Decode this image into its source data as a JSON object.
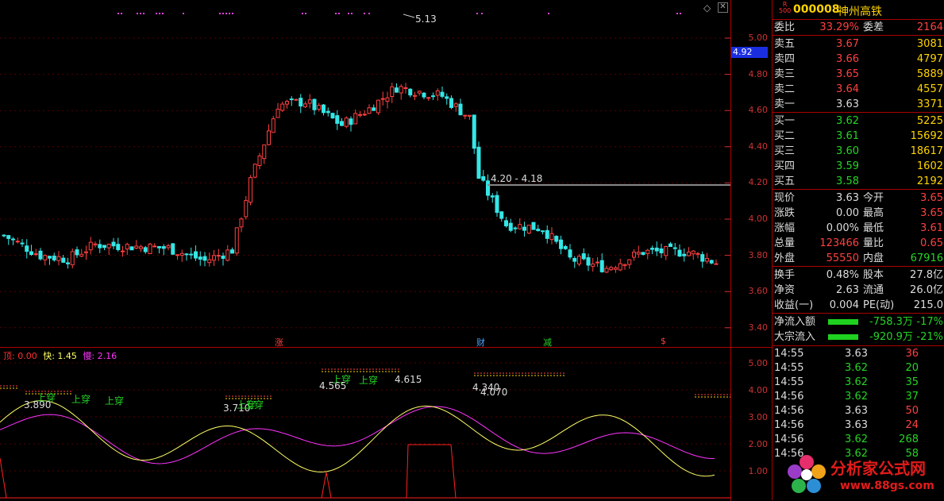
{
  "stock": {
    "board_tag": "R\n500",
    "code": "000008",
    "name": "神州高铁"
  },
  "chart": {
    "price_ticks": [
      "5.00",
      "4.80",
      "4.60",
      "4.40",
      "4.20",
      "4.00",
      "3.80",
      "3.60",
      "3.40"
    ],
    "current_price_tag": "4.92",
    "high_label": "5.13",
    "range_label": "4.20 - 4.18",
    "event_flags": [
      {
        "label": "涨",
        "color": "#ff4040"
      },
      {
        "label": "财",
        "color": "#4aa3ff"
      },
      {
        "label": "减",
        "color": "#25d425"
      },
      {
        "label": "$",
        "color": "#ff4040"
      }
    ],
    "indicator_ticks": [
      "5.00",
      "4.00",
      "3.00",
      "2.00",
      "1.00"
    ],
    "legend": {
      "top_label": "顶: 0.00",
      "fast_label": "快: 1.45",
      "slow_label": "慢: 2.16"
    },
    "annotations": [
      {
        "text": "上穿",
        "color": "#25d425"
      },
      {
        "text": "上穿",
        "color": "#25d425"
      },
      {
        "text": "上穿",
        "color": "#25d425"
      },
      {
        "text": "3.890",
        "color": "#ddd"
      },
      {
        "text": "3.710",
        "color": "#ddd"
      },
      {
        "text": "上穿",
        "color": "#25d425"
      },
      {
        "text": "上穿",
        "color": "#25d425"
      },
      {
        "text": "上穿",
        "color": "#25d425"
      },
      {
        "text": "上穿",
        "color": "#25d425"
      },
      {
        "text": "4.615",
        "color": "#ddd"
      },
      {
        "text": "4.565",
        "color": "#ddd"
      },
      {
        "text": "4.340",
        "color": "#ddd"
      },
      {
        "text": "4.070",
        "color": "#ddd"
      }
    ],
    "colors": {
      "up": "#ff4040",
      "down": "#35e6e6",
      "fast": "#ffff66",
      "slow": "#ff33ff",
      "top": "#ff2020"
    }
  },
  "panel": {
    "wei": {
      "l1": "委比",
      "v1": "33.29%",
      "l2": "委差",
      "v2": "2164"
    },
    "asks": [
      {
        "label": "卖五",
        "price": "3.67",
        "vol": "3081"
      },
      {
        "label": "卖四",
        "price": "3.66",
        "vol": "4797"
      },
      {
        "label": "卖三",
        "price": "3.65",
        "vol": "5889"
      },
      {
        "label": "卖二",
        "price": "3.64",
        "vol": "4557"
      },
      {
        "label": "卖一",
        "price": "3.63",
        "vol": "3371"
      }
    ],
    "bids": [
      {
        "label": "买一",
        "price": "3.62",
        "vol": "5225"
      },
      {
        "label": "买二",
        "price": "3.61",
        "vol": "15692"
      },
      {
        "label": "买三",
        "price": "3.60",
        "vol": "18617"
      },
      {
        "label": "买四",
        "price": "3.59",
        "vol": "1602"
      },
      {
        "label": "买五",
        "price": "3.58",
        "vol": "2192"
      }
    ],
    "stats": [
      {
        "l1": "现价",
        "v1": "3.63",
        "l2": "今开",
        "v2": "3.65"
      },
      {
        "l1": "涨跌",
        "v1": "0.00",
        "l2": "最高",
        "v2": "3.65"
      },
      {
        "l1": "涨幅",
        "v1": "0.00%",
        "l2": "最低",
        "v2": "3.61"
      },
      {
        "l1": "总量",
        "v1": "123466",
        "l2": "量比",
        "v2": "0.65"
      },
      {
        "l1": "外盘",
        "v1": "55550",
        "l2": "内盘",
        "v2": "67916"
      }
    ],
    "fin": [
      {
        "l1": "换手",
        "v1": "0.48%",
        "l2": "股本",
        "v2": "27.8亿"
      },
      {
        "l1": "净资",
        "v1": "2.63",
        "l2": "流通",
        "v2": "26.0亿"
      },
      {
        "l1": "收益(一)",
        "v1": "0.004",
        "l2": "PE(动)",
        "v2": "215.0"
      }
    ],
    "flow": [
      {
        "label": "净流入额",
        "value": "-758.3万",
        "pct": "-17%"
      },
      {
        "label": "大宗流入",
        "value": "-920.9万",
        "pct": "-21%"
      }
    ],
    "ticks": [
      {
        "time": "14:55",
        "price": "3.63",
        "vol": "36",
        "pc": "eq",
        "vc": "up"
      },
      {
        "time": "14:55",
        "price": "3.62",
        "vol": "20",
        "pc": "dn",
        "vc": "dn"
      },
      {
        "time": "14:55",
        "price": "3.62",
        "vol": "35",
        "pc": "dn",
        "vc": "dn"
      },
      {
        "time": "14:56",
        "price": "3.62",
        "vol": "37",
        "pc": "dn",
        "vc": "dn"
      },
      {
        "time": "14:56",
        "price": "3.63",
        "vol": "50",
        "pc": "eq",
        "vc": "up"
      },
      {
        "time": "14:56",
        "price": "3.63",
        "vol": "24",
        "pc": "eq",
        "vc": "up"
      },
      {
        "time": "14:56",
        "price": "3.62",
        "vol": "268",
        "pc": "dn",
        "vc": "dn"
      },
      {
        "time": "14:56",
        "price": "3.62",
        "vol": "58",
        "pc": "dn",
        "vc": "dn"
      }
    ]
  },
  "watermark": {
    "title": "分析家公式网",
    "url": "www.88gs.com"
  }
}
